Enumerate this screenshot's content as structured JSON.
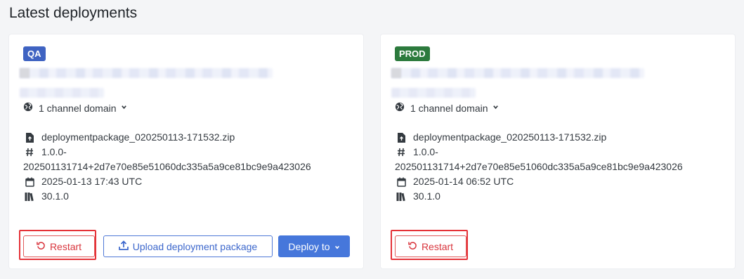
{
  "page": {
    "title": "Latest deployments"
  },
  "colors": {
    "qa_badge": "#3f63c2",
    "prod_badge": "#2c7a3d",
    "restart": "#d9363e",
    "primary": "#4677db",
    "highlight": "#e53238"
  },
  "cards": [
    {
      "env": "QA",
      "domains_label": "1 channel domain",
      "package": "deploymentpackage_020250113-171532.zip",
      "version": "1.0.0-202501131714+2d7e70e85e51060dc335a5a9ce81bc9e9a423026",
      "date": "2025-01-13 17:43 UTC",
      "library": "30.1.0",
      "restart_label": "Restart",
      "upload_label": "Upload deployment package",
      "deploy_label": "Deploy to"
    },
    {
      "env": "PROD",
      "domains_label": "1 channel domain",
      "package": "deploymentpackage_020250113-171532.zip",
      "version": "1.0.0-202501131714+2d7e70e85e51060dc335a5a9ce81bc9e9a423026",
      "date": "2025-01-14 06:52 UTC",
      "library": "30.1.0",
      "restart_label": "Restart"
    }
  ],
  "icons": {
    "globe": "globe-icon",
    "file": "file-upload-icon",
    "hash": "hash-icon",
    "calendar": "calendar-icon",
    "library": "library-icon",
    "restart": "restart-icon",
    "upload": "upload-icon",
    "chevron": "chevron-down-icon"
  }
}
